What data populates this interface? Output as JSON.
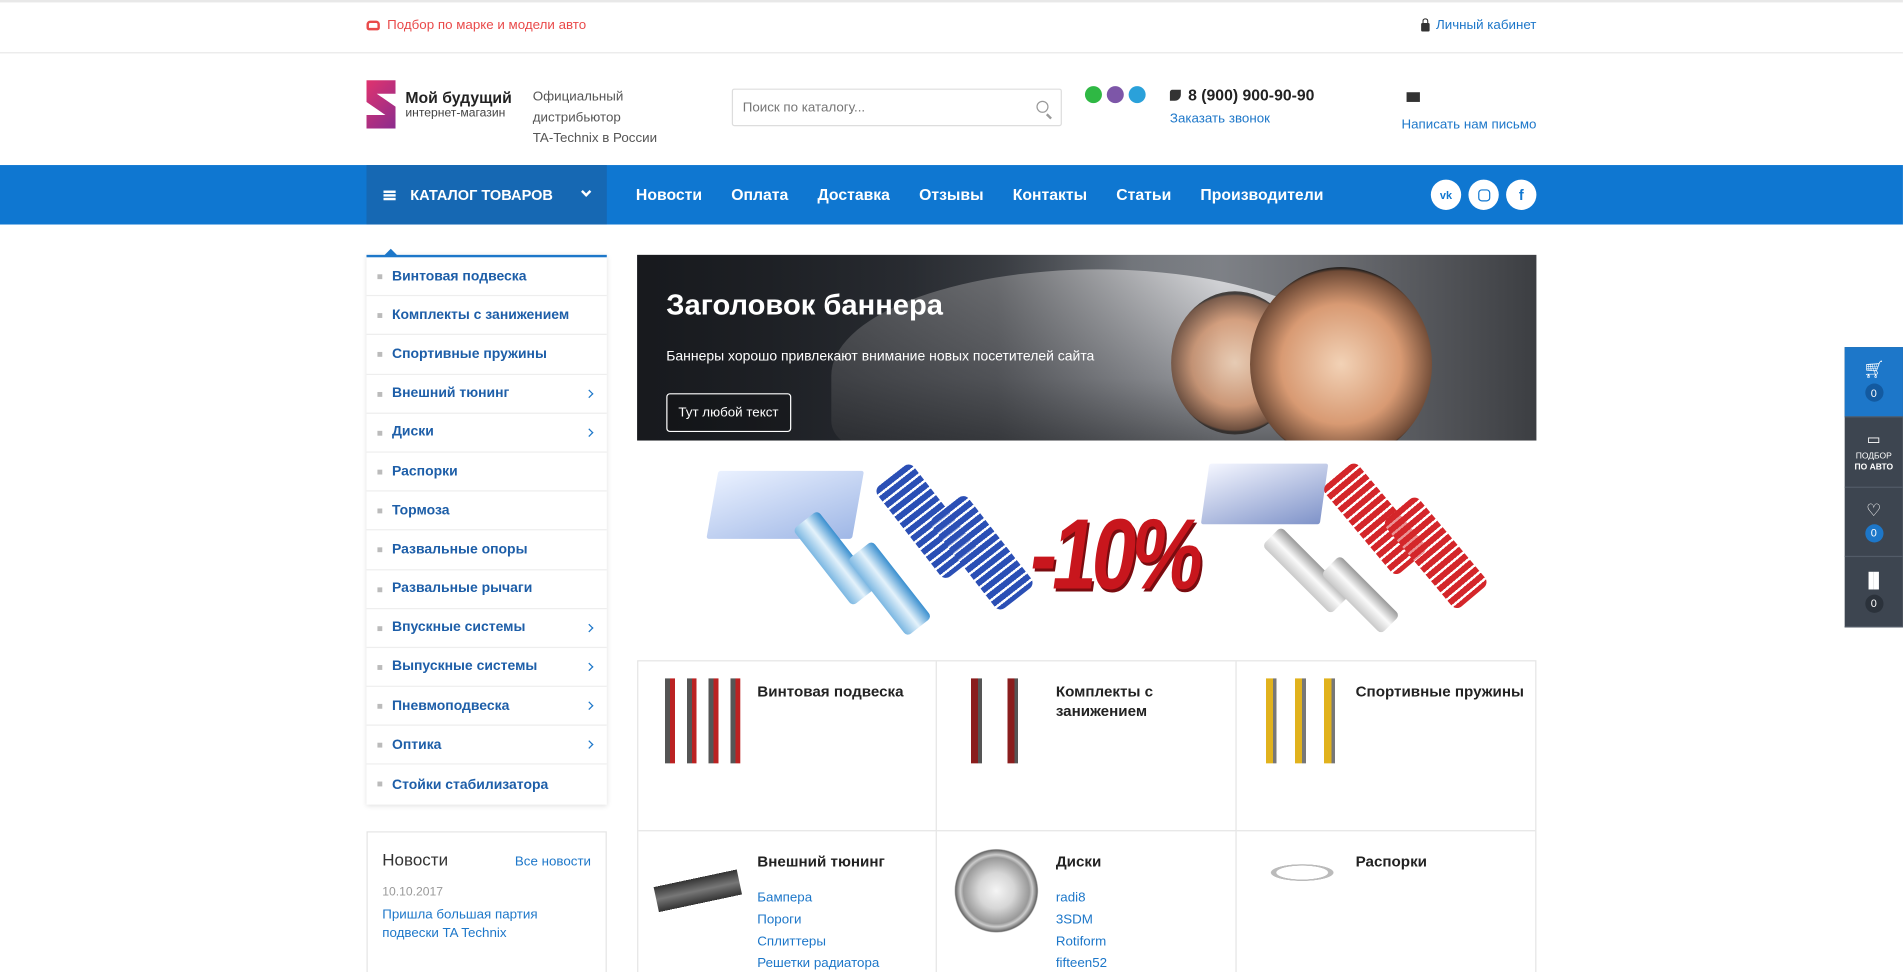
{
  "topbar": {
    "car_pick_label": "Подбор по марке и модели авто",
    "cabinet_label": "Личный кабинет"
  },
  "header": {
    "logo_line1": "Мой будущий",
    "logo_line2": "интернет-магазин",
    "distributor_line1": "Официальный дистрибьютор",
    "distributor_line2": "TA-Technix в России",
    "search_placeholder": "Поиск по каталогу...",
    "phone": "8 (900) 900-90-90",
    "order_call": "Заказать звонок",
    "write_us": "Написать нам письмо",
    "messenger_colors": [
      "#2fb844",
      "#7d56a8",
      "#2aa1da"
    ]
  },
  "nav": {
    "catalog_label": "КАТАЛОГ ТОВАРОВ",
    "items": [
      "Новости",
      "Оплата",
      "Доставка",
      "Отзывы",
      "Контакты",
      "Статьи",
      "Производители"
    ],
    "social": [
      "vk",
      "instagram",
      "f"
    ]
  },
  "sidebar": {
    "items": [
      {
        "label": "Винтовая подвеска",
        "has_sub": false
      },
      {
        "label": "Комплекты с занижением",
        "has_sub": false
      },
      {
        "label": "Спортивные пружины",
        "has_sub": false
      },
      {
        "label": "Внешний тюнинг",
        "has_sub": true
      },
      {
        "label": "Диски",
        "has_sub": true
      },
      {
        "label": "Распорки",
        "has_sub": false
      },
      {
        "label": "Тормоза",
        "has_sub": false
      },
      {
        "label": "Развальные опоры",
        "has_sub": false
      },
      {
        "label": "Развальные рычаги",
        "has_sub": false
      },
      {
        "label": "Впускные системы",
        "has_sub": true
      },
      {
        "label": "Выпускные системы",
        "has_sub": true
      },
      {
        "label": "Пневмоподвеска",
        "has_sub": true
      },
      {
        "label": "Оптика",
        "has_sub": true
      },
      {
        "label": "Стойки стабилизатора",
        "has_sub": false
      }
    ]
  },
  "news": {
    "title": "Новости",
    "all_link": "Все новости",
    "date": "10.10.2017",
    "text": "Пришла большая партия подвески TA Technix"
  },
  "banner": {
    "title": "Заголовок баннера",
    "subtitle": "Баннеры хорошо привлекают внимание новых посетителей сайта",
    "button": "Тут любой текст"
  },
  "promo": {
    "discount": "-10%"
  },
  "categories": [
    {
      "name": "Винтовая подвеска",
      "subs": []
    },
    {
      "name": "Комплекты с занижением",
      "subs": []
    },
    {
      "name": "Спортивные пружины",
      "subs": []
    },
    {
      "name": "Внешний тюнинг",
      "subs": [
        "Бампера",
        "Пороги",
        "Сплиттеры",
        "Решетки радиатора"
      ]
    },
    {
      "name": "Диски",
      "subs": [
        "radi8",
        "3SDM",
        "Rotiform",
        "fifteen52"
      ]
    },
    {
      "name": "Распорки",
      "subs": []
    }
  ],
  "right_panel": {
    "cart_count": "0",
    "auto_caption_1": "ПОДБОР",
    "auto_caption_2": "ПО АВТО",
    "wish_count": "0",
    "compare_count": "0"
  },
  "colors": {
    "accent": "#0f77d1",
    "link": "#1d77c9",
    "alert": "#e94a4a",
    "discount": "#c8161d"
  }
}
